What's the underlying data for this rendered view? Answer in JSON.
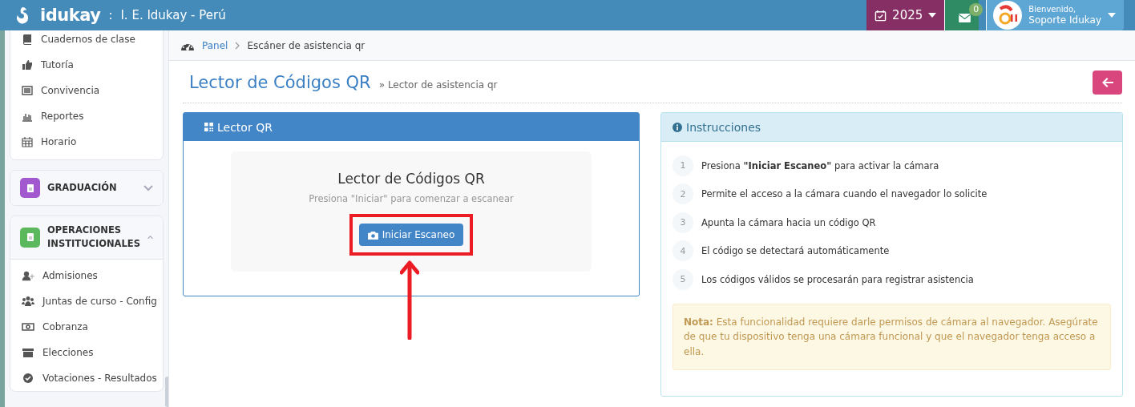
{
  "header": {
    "brand": "idukay",
    "separator": ":",
    "school": "I. E. Idukay - Perú",
    "year": "2025",
    "messages_count": "0",
    "welcome": "Bienvenido,",
    "user": "Soporte Idukay"
  },
  "sidebar": {
    "items": [
      {
        "label": "Cuadernos de clase"
      },
      {
        "label": "Tutoría"
      },
      {
        "label": "Convivencia"
      },
      {
        "label": "Reportes"
      },
      {
        "label": "Horario"
      }
    ],
    "groups": [
      {
        "label": "GRADUACIÓN",
        "color": "#a259d0",
        "expanded": false
      },
      {
        "label": "OPERACIONES INSTITUCIONALES",
        "color": "#5cb85c",
        "expanded": true,
        "items": [
          {
            "label": "Admisiones"
          },
          {
            "label": "Juntas de curso - Config"
          },
          {
            "label": "Cobranza"
          },
          {
            "label": "Elecciones"
          },
          {
            "label": "Votaciones - Resultados"
          }
        ]
      }
    ]
  },
  "breadcrumb": [
    {
      "label": "Panel",
      "link": true
    },
    {
      "label": "Escáner de asistencia qr",
      "link": false
    }
  ],
  "page": {
    "title": "Lector de Códigos QR",
    "subtitle": "» Lector de asistencia qr"
  },
  "scanner": {
    "header": "Lector QR",
    "title": "Lector de Códigos QR",
    "hint": "Presiona \"Iniciar\" para comenzar a escanear",
    "button": "Iniciar Escaneo"
  },
  "instructions": {
    "header": "Instrucciones",
    "steps": [
      {
        "number": "1",
        "text": "Presiona **\"Iniciar Escaneo\"** para activar la cámara"
      },
      {
        "number": "2",
        "text": "Permite el acceso a la cámara cuando el navegador lo solicite"
      },
      {
        "number": "3",
        "text": "Apunta la cámara hacia un código QR"
      },
      {
        "number": "4",
        "text": "El código se detectará automáticamente"
      },
      {
        "number": "5",
        "text": "Los códigos válidos se procesarán para registrar asistencia"
      }
    ],
    "note": "**Nota:** Esta funcionalidad requiere darle permisos de cámara al navegador. Asegúrate de que tu dispositivo tenga una cámara funcional y que el navegador tenga acceso a ella."
  }
}
